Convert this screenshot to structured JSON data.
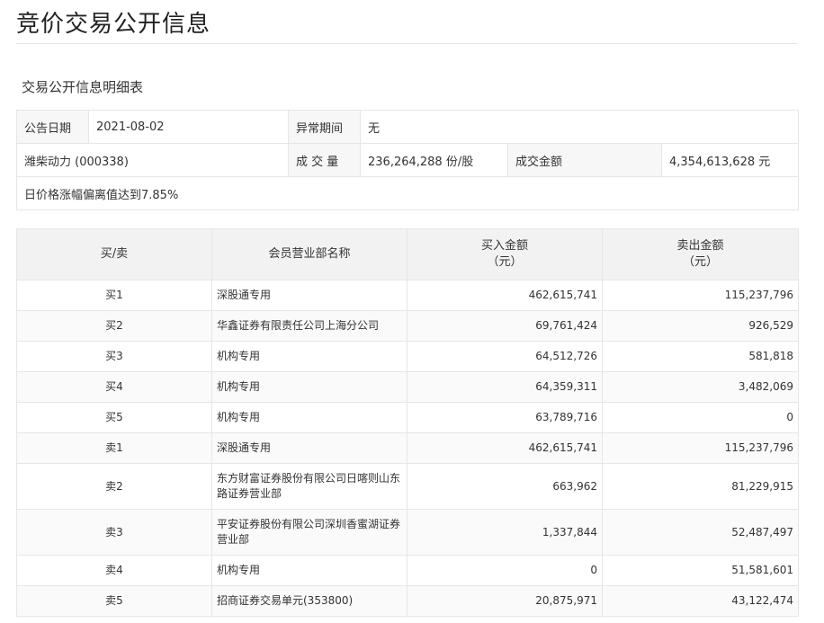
{
  "page": {
    "title": "竞价交易公开信息",
    "subtitle": "交易公开信息明细表"
  },
  "info": {
    "announce_date_label": "公告日期",
    "announce_date": "2021-08-02",
    "abnormal_period_label": "异常期间",
    "abnormal_period": "无",
    "stock": "潍柴动力 (000338)",
    "volume_label": "成 交 量",
    "volume": "236,264,288 份/股",
    "turnover_label": "成交金额",
    "turnover": "4,354,613,628 元",
    "reason": "日价格涨幅偏离值达到7.85%"
  },
  "table": {
    "headers": {
      "side": "买/卖",
      "branch": "会员营业部名称",
      "buy_line1": "买入金额",
      "buy_line2": "（元）",
      "sell_line1": "卖出金额",
      "sell_line2": "（元）"
    },
    "rows": [
      {
        "side": "买1",
        "branch": "深股通专用",
        "buy": "462,615,741",
        "sell": "115,237,796"
      },
      {
        "side": "买2",
        "branch": "华鑫证券有限责任公司上海分公司",
        "buy": "69,761,424",
        "sell": "926,529"
      },
      {
        "side": "买3",
        "branch": "机构专用",
        "buy": "64,512,726",
        "sell": "581,818"
      },
      {
        "side": "买4",
        "branch": "机构专用",
        "buy": "64,359,311",
        "sell": "3,482,069"
      },
      {
        "side": "买5",
        "branch": "机构专用",
        "buy": "63,789,716",
        "sell": "0"
      },
      {
        "side": "卖1",
        "branch": "深股通专用",
        "buy": "462,615,741",
        "sell": "115,237,796"
      },
      {
        "side": "卖2",
        "branch": "东方财富证券股份有限公司日喀则山东路证券营业部",
        "buy": "663,962",
        "sell": "81,229,915"
      },
      {
        "side": "卖3",
        "branch": "平安证券股份有限公司深圳香蜜湖证券营业部",
        "buy": "1,337,844",
        "sell": "52,487,497"
      },
      {
        "side": "卖4",
        "branch": "机构专用",
        "buy": "0",
        "sell": "51,581,601"
      },
      {
        "side": "卖5",
        "branch": "招商证券交易单元(353800)",
        "buy": "20,875,971",
        "sell": "43,122,474"
      }
    ]
  }
}
